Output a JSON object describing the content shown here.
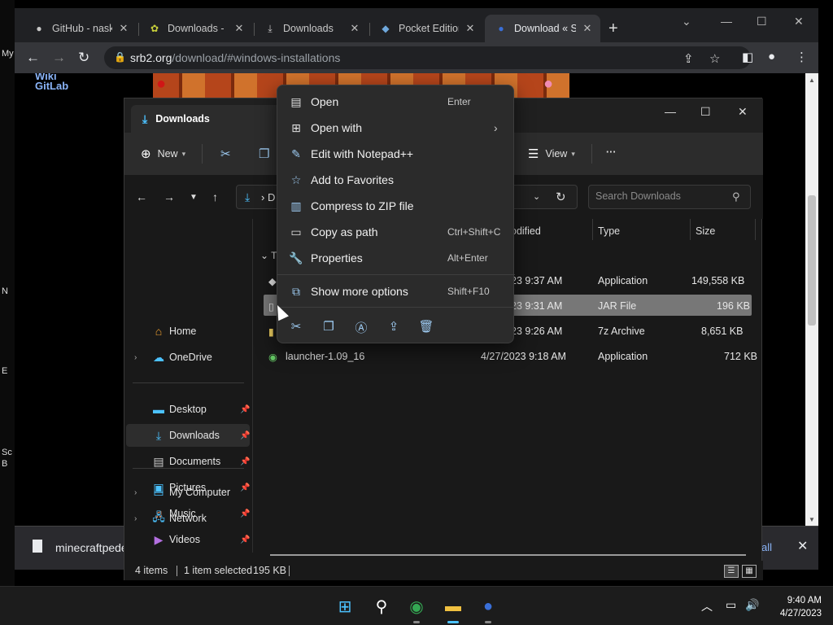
{
  "desktop": {
    "left_labels": [
      "My",
      "N",
      "E",
      "Sc",
      "B"
    ]
  },
  "browser": {
    "tabs": [
      {
        "label": "GitHub - nask",
        "icon": "github-icon"
      },
      {
        "label": "Downloads - B",
        "icon": "bitbucket-icon"
      },
      {
        "label": "Downloads",
        "icon": "download-icon"
      },
      {
        "label": "Pocket Edition",
        "icon": "cube-icon"
      },
      {
        "label": "Download « S",
        "icon": "sonic-icon"
      }
    ],
    "url_host": "srb2.org",
    "url_path": "/download/#windows-installations",
    "page_links": [
      "Wiki",
      "GitLab"
    ],
    "download_bar": {
      "file": "minecraftpede",
      "show_all": "all",
      "close": "✕"
    }
  },
  "explorer": {
    "title": "Downloads",
    "commands": {
      "new": "New",
      "view": "View",
      "more": "···"
    },
    "address_segment": "D",
    "search_placeholder": "Search Downloads",
    "nav": {
      "home": "Home",
      "onedrive": "OneDrive",
      "desktop": "Desktop",
      "downloads": "Downloads",
      "documents": "Documents",
      "pictures": "Pictures",
      "music": "Music",
      "videos": "Videos",
      "my_computer": "My Computer",
      "network": "Network"
    },
    "columns": {
      "modified": "odified",
      "type": "Type",
      "size": "Size"
    },
    "group_header": "T",
    "files": [
      {
        "name": "",
        "modified": "23 9:37 AM",
        "type": "Application",
        "size": "149,558 KB"
      },
      {
        "name": "",
        "modified": "23 9:31 AM",
        "type": "JAR File",
        "size": "196 KB"
      },
      {
        "name": "",
        "modified": "23 9:26 AM",
        "type": "7z Archive",
        "size": "8,651 KB"
      },
      {
        "name": "launcher-1.09_16",
        "modified": "4/27/2023 9:18 AM",
        "type": "Application",
        "size": "712 KB"
      }
    ],
    "status": {
      "items": "4 items",
      "selected": "1 item selected",
      "size": "195 KB"
    }
  },
  "context_menu": {
    "items": [
      {
        "label": "Open",
        "shortcut": "Enter",
        "icon": "open-icon"
      },
      {
        "label": "Open with",
        "shortcut": "",
        "icon": "open-with-icon"
      },
      {
        "label": "Edit with Notepad++",
        "shortcut": "",
        "icon": "notepadpp-icon"
      },
      {
        "label": "Add to Favorites",
        "shortcut": "",
        "icon": "star-icon"
      },
      {
        "label": "Compress to ZIP file",
        "shortcut": "",
        "icon": "zip-icon"
      },
      {
        "label": "Copy as path",
        "shortcut": "Ctrl+Shift+C",
        "icon": "copy-path-icon"
      },
      {
        "label": "Properties",
        "shortcut": "Alt+Enter",
        "icon": "properties-icon"
      },
      {
        "label": "Show more options",
        "shortcut": "Shift+F10",
        "icon": "more-options-icon"
      }
    ],
    "quick_actions": [
      "cut-icon",
      "copy-icon",
      "rename-icon",
      "share-icon",
      "delete-icon"
    ]
  },
  "taskbar": {
    "time": "9:40 AM",
    "date": "4/27/2023"
  },
  "colors": {
    "accent": "#4cc2ff",
    "selection": "#777777",
    "menu_bg": "#2b2b2b"
  }
}
